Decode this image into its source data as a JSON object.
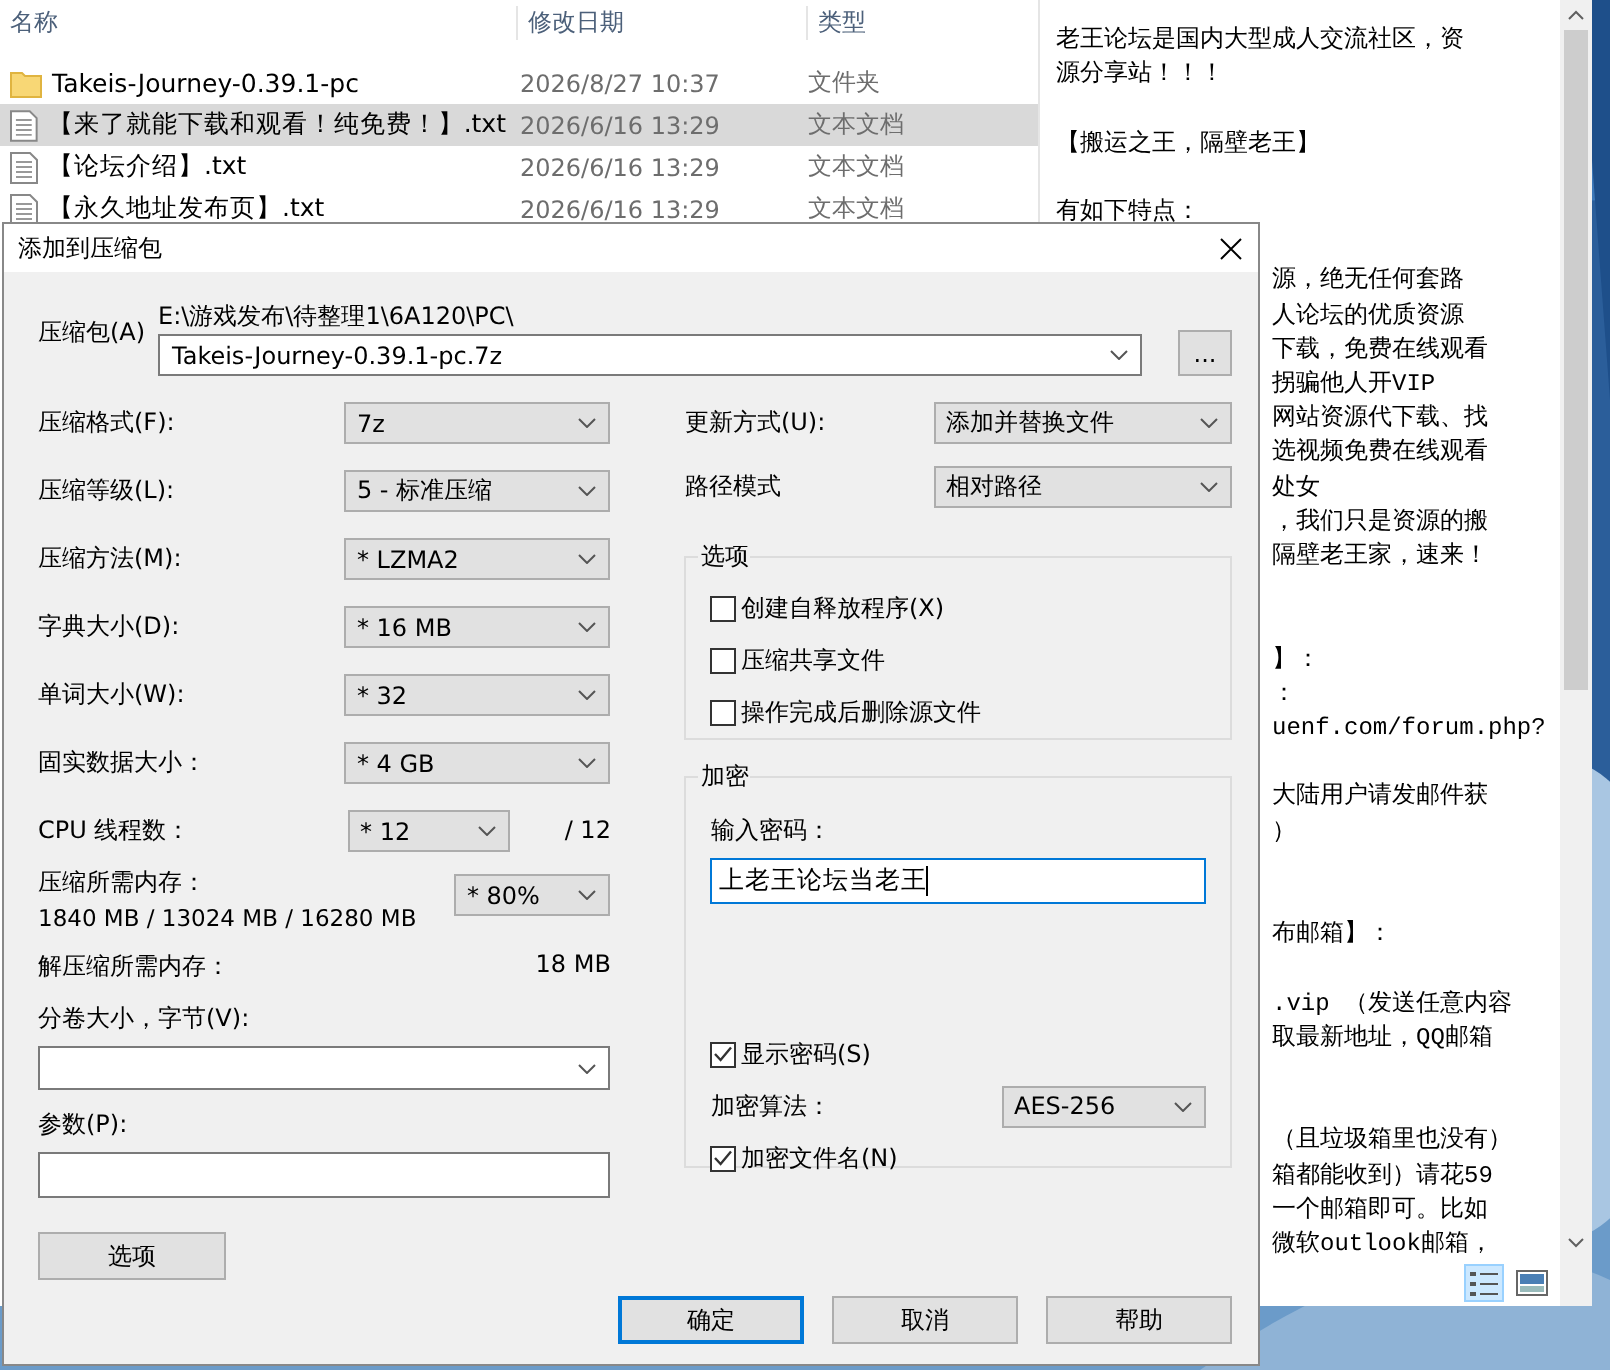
{
  "explorer": {
    "columns": [
      "名称",
      "修改日期",
      "类型"
    ],
    "files": [
      {
        "kind": "folder",
        "name": "Takeis-Journey-0.39.1-pc",
        "modified": "2026/8/27 10:37",
        "type": "文件夹",
        "selected": false
      },
      {
        "kind": "text",
        "name": "【来了就能下载和观看！纯免费！】.txt",
        "modified": "2026/6/16 13:29",
        "type": "文本文档",
        "selected": true
      },
      {
        "kind": "text",
        "name": "【论坛介绍】.txt",
        "modified": "2026/6/16 13:29",
        "type": "文本文档",
        "selected": false
      },
      {
        "kind": "text",
        "name": "【永久地址发布页】.txt",
        "modified": "2026/6/16 13:29",
        "type": "文本文档",
        "selected": false
      }
    ],
    "preview": {
      "top_paragraphs": [
        [
          "老王论坛是国内大型成人交流社区，资",
          "源分享站！！！"
        ],
        [
          "【搬运之王，隔壁老王】"
        ],
        [
          "有如下特点："
        ]
      ],
      "visible_fragments": [
        [
          "源，绝无任何套路",
          "人论坛的优质资源",
          "下载，免费在线观看",
          "拐骗他人开VIP",
          "网站资源代下载、找",
          "选视频免费在线观看",
          "处女",
          "，我们只是资源的搬",
          "隔壁老王家，速来！"
        ],
        [
          "】：",
          "：",
          "uenf.com/forum.php?"
        ],
        [
          "大陆用户请发邮件获",
          "）"
        ],
        [
          "布邮箱】："
        ],
        [
          ".vip  （发送任意内容",
          "取最新地址，QQ邮箱"
        ],
        [
          "（且垃圾箱里也没有）",
          "箱都能收到）请花59",
          "一个邮箱即可。比如",
          "微软outlook邮箱，"
        ]
      ]
    },
    "view_buttons": [
      {
        "kind": "details",
        "selected": true
      },
      {
        "kind": "preview",
        "selected": false
      }
    ]
  },
  "dialog": {
    "title": "添加到压缩包",
    "archive": {
      "label": "压缩包(A)",
      "path": "E:\\游戏发布\\待整理1\\6A120\\PC\\",
      "value": "Takeis-Journey-0.39.1-pc.7z",
      "browse": "..."
    },
    "settings": [
      {
        "label": "压缩格式(F):",
        "value": "7z"
      },
      {
        "label": "压缩等级(L):",
        "value": "5 - 标准压缩"
      },
      {
        "label": "压缩方法(M):",
        "value": "* LZMA2"
      },
      {
        "label": "字典大小(D):",
        "value": "* 16 MB"
      },
      {
        "label": "单词大小(W):",
        "value": "* 32"
      },
      {
        "label": "固实数据大小：",
        "value": "* 4 GB"
      }
    ],
    "threads": {
      "label": "CPU 线程数：",
      "value": "* 12",
      "total": "/ 12"
    },
    "memory": {
      "label": "压缩所需内存：",
      "detail": "1840 MB / 13024 MB / 16280 MB",
      "value": "* 80%"
    },
    "decompress": {
      "label": "解压缩所需内存：",
      "value": "18 MB"
    },
    "volume": {
      "label": "分卷大小，字节(V):"
    },
    "params": {
      "label": "参数(P):"
    },
    "options_button": "选项",
    "update": {
      "label": "更新方式(U):",
      "value": "添加并替换文件"
    },
    "path_mode": {
      "label": "路径模式",
      "value": "相对路径"
    },
    "options_group": {
      "title": "选项",
      "checkboxes": [
        {
          "label": "创建自释放程序(X)",
          "checked": false
        },
        {
          "label": "压缩共享文件",
          "checked": false
        },
        {
          "label": "操作完成后删除源文件",
          "checked": false
        }
      ]
    },
    "encryption": {
      "title": "加密",
      "password_label": "输入密码：",
      "password": "上老王论坛当老王",
      "show_password": {
        "label": "显示密码(S)",
        "checked": true
      },
      "method_label": "加密算法：",
      "method": "AES-256",
      "encrypt_names": {
        "label": "加密文件名(N)",
        "checked": true
      }
    },
    "buttons": [
      {
        "label": "确定",
        "default": true
      },
      {
        "label": "取消",
        "default": false
      },
      {
        "label": "帮助",
        "default": false
      }
    ]
  }
}
